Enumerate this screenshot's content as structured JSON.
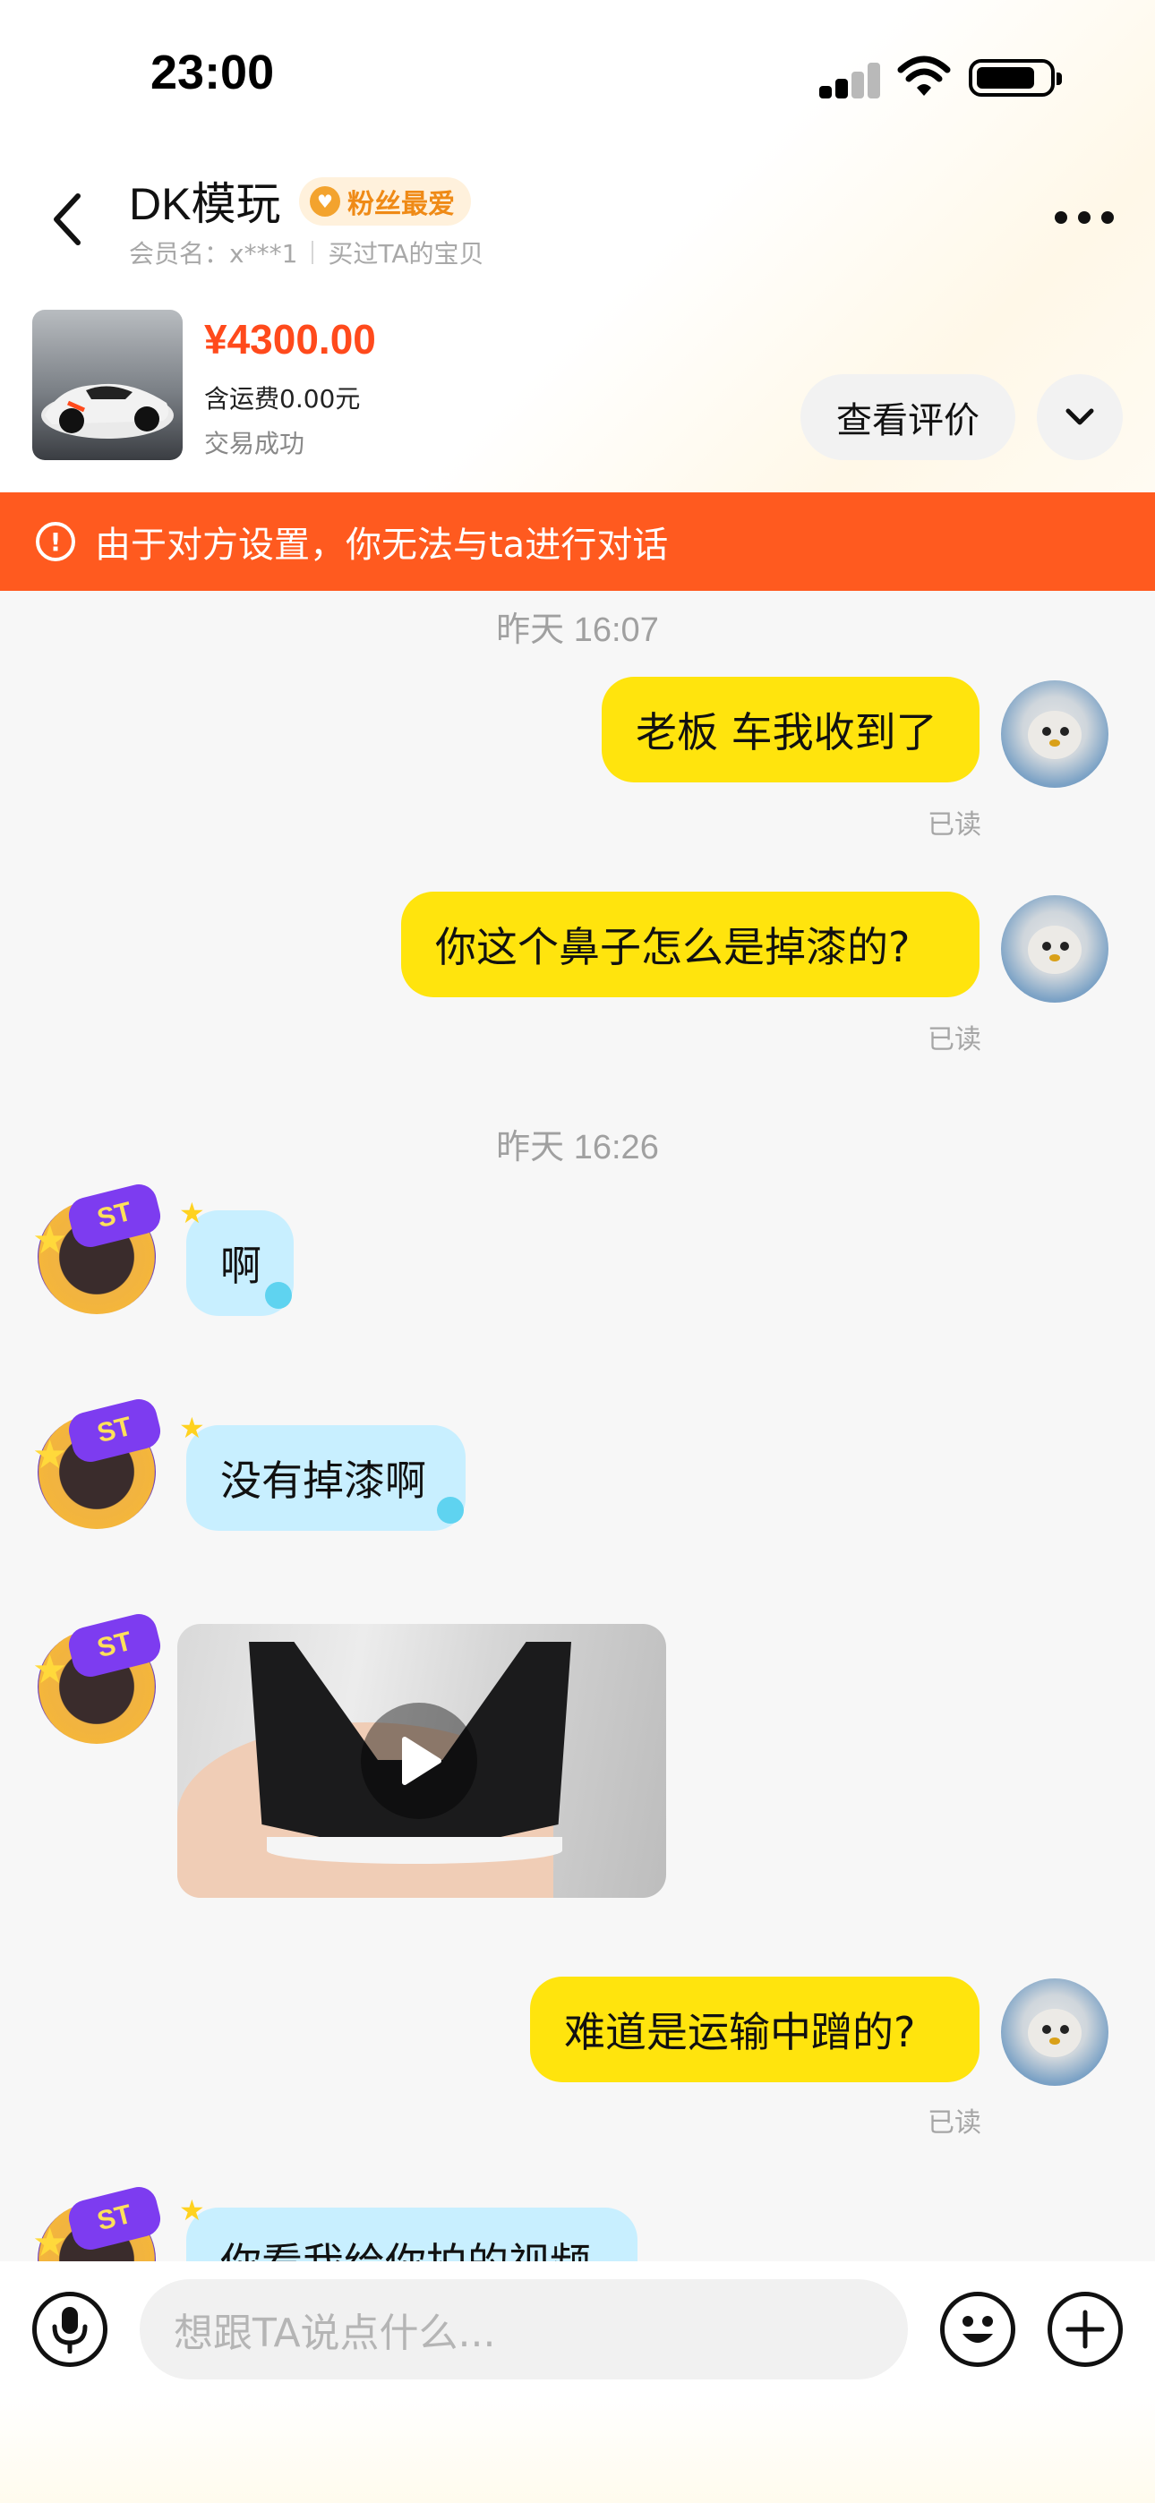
{
  "status_bar": {
    "time": "23:00"
  },
  "header": {
    "shop_name": "DK模玩",
    "fan_badge": "粉丝最爱",
    "member_label": "会员名：x***1",
    "purchase_note": "买过TA的宝贝",
    "more_icon": "more-dots-icon",
    "back_icon": "chevron-left-icon"
  },
  "product": {
    "price": "¥4300.00",
    "shipping": "含运费0.00元",
    "status": "交易成功",
    "review_button": "查看评价",
    "expand_icon": "chevron-down-icon"
  },
  "notice": {
    "text": "由于对方设置，你无法与ta进行对话",
    "icon": "warning-icon"
  },
  "chat": {
    "timestamps": [
      "昨天 16:07",
      "昨天 16:26"
    ],
    "messages": [
      {
        "sender": "me",
        "text": "老板 车我收到了",
        "status": "已读"
      },
      {
        "sender": "me",
        "text": "你这个鼻子怎么是掉漆的?",
        "status": "已读"
      },
      {
        "sender": "them",
        "text": "啊"
      },
      {
        "sender": "them",
        "text": "没有掉漆啊"
      },
      {
        "sender": "them",
        "type": "video"
      },
      {
        "sender": "me",
        "text": "难道是运输中蹭的?",
        "status": "已读"
      },
      {
        "sender": "them",
        "text": "你看我给你拍的视频"
      }
    ]
  },
  "input_bar": {
    "placeholder": "想跟TA说点什么...",
    "icons": [
      "microphone-icon",
      "emoji-icon",
      "plus-icon"
    ]
  },
  "colors": {
    "my_bubble": "#ffe40d",
    "their_bubble": "#c8efff",
    "notice_bg": "#ff5a1f",
    "price": "#ff4a1c"
  }
}
